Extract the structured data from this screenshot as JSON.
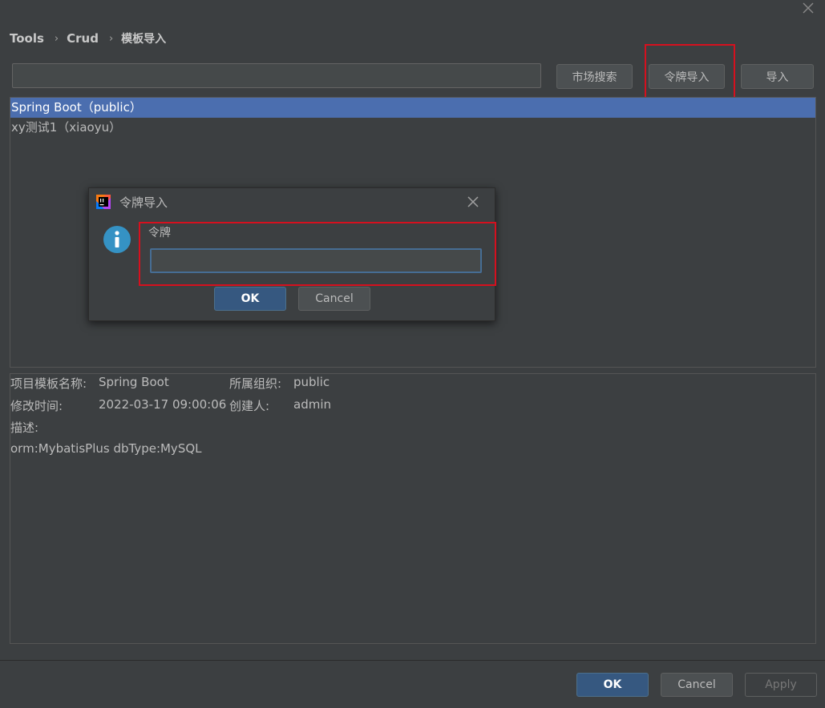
{
  "breadcrumb": [
    "Tools",
    "Crud",
    "模板导入"
  ],
  "search": {
    "value": "",
    "placeholder": ""
  },
  "toolbar": {
    "market_search": "市场搜索",
    "token_import": "令牌导入",
    "import": "导入"
  },
  "templates": [
    {
      "label": "Spring Boot（public）",
      "selected": true
    },
    {
      "label": "xy测试1（xiaoyu）",
      "selected": false
    }
  ],
  "details": {
    "name_label": "项目模板名称:",
    "name_value": "Spring Boot",
    "org_label": "所属组织:",
    "org_value": "public",
    "modified_label": "修改时间:",
    "modified_value": "2022-03-17 09:00:06",
    "creator_label": "创建人:",
    "creator_value": "admin",
    "desc_label": "描述:",
    "desc_value": "orm:MybatisPlus dbType:MySQL"
  },
  "dialog": {
    "title": "令牌导入",
    "field_label": "令牌",
    "input_value": "",
    "ok": "OK",
    "cancel": "Cancel"
  },
  "footer": {
    "ok": "OK",
    "cancel": "Cancel",
    "apply": "Apply"
  },
  "colors": {
    "background": "#3c3f41",
    "selection": "#4b6eaf",
    "primary_button": "#365880",
    "highlight_box": "#d6101e",
    "info_icon": "#3592c4"
  },
  "icons": [
    "close-icon",
    "intellij-logo-icon",
    "info-icon"
  ]
}
